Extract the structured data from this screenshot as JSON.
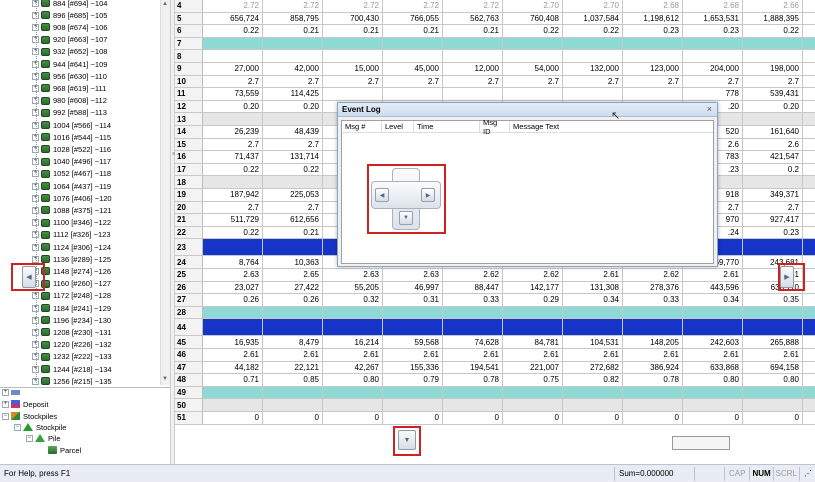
{
  "tree": {
    "blocks": [
      "884 [#694] ~104",
      "896 [#685] ~105",
      "908 [#674] ~106",
      "920 [#663] ~107",
      "932 [#652] ~108",
      "944 [#641] ~109",
      "956 [#630] ~110",
      "968 [#619] ~111",
      "980 [#608] ~112",
      "992 [#588] ~113",
      "1004 [#566] ~114",
      "1016 [#544] ~115",
      "1028 [#522] ~116",
      "1040 [#496] ~117",
      "1052 [#467] ~118",
      "1064 [#437] ~119",
      "1076 [#406] ~120",
      "1088 [#375] ~121",
      "1100 [#346] ~122",
      "1112 [#326] ~123",
      "1124 [#306] ~124",
      "1136 [#289] ~125",
      "1148 [#274] ~126",
      "1160 [#260] ~127",
      "1172 [#248] ~128",
      "1184 [#241] ~129",
      "1196 [#234] ~130",
      "1208 [#230] ~131",
      "1220 [#226] ~132",
      "1232 [#222] ~133",
      "1244 [#218] ~134",
      "1256 [#215] ~135",
      "1268 [#212] ~136"
    ],
    "bottom": {
      "deposit": "Deposit",
      "stockpiles": "Stockpiles",
      "stockpile": "Stockpile",
      "pile": "Pile",
      "parcel": "Parcel"
    }
  },
  "grid": {
    "rows": [
      {
        "n": "4",
        "style": "faded",
        "v": [
          "2.72",
          "2.72",
          "2.72",
          "2.72",
          "2.72",
          "2.70",
          "2.70",
          "2.68",
          "2.68",
          "2.66"
        ]
      },
      {
        "n": "5",
        "style": "",
        "v": [
          "656,724",
          "858,795",
          "700,430",
          "766,055",
          "562,763",
          "760,408",
          "1,037,584",
          "1,198,612",
          "1,653,531",
          "1,888,395"
        ]
      },
      {
        "n": "6",
        "style": "",
        "v": [
          "0.22",
          "0.21",
          "0.21",
          "0.21",
          "0.21",
          "0.22",
          "0.22",
          "0.23",
          "0.23",
          "0.22"
        ]
      },
      {
        "n": "7",
        "style": "band-cyan",
        "v": [
          "",
          "",
          "",
          "",
          "",
          "",
          "",
          "",
          "",
          ""
        ]
      },
      {
        "n": "8",
        "style": "",
        "v": [
          "",
          "",
          "",
          "",
          "",
          "",
          "",
          "",
          "",
          ""
        ]
      },
      {
        "n": "9",
        "style": "",
        "v": [
          "27,000",
          "42,000",
          "15,000",
          "45,000",
          "12,000",
          "54,000",
          "132,000",
          "123,000",
          "204,000",
          "198,000"
        ]
      },
      {
        "n": "10",
        "style": "",
        "v": [
          "2.7",
          "2.7",
          "2.7",
          "2.7",
          "2.7",
          "2.7",
          "2.7",
          "2.7",
          "2.7",
          "2.7"
        ]
      },
      {
        "n": "11",
        "style": "",
        "v": [
          "73,559",
          "114,425",
          "",
          "",
          "",
          "",
          "",
          "",
          "778",
          "539,431"
        ]
      },
      {
        "n": "12",
        "style": "",
        "v": [
          "0.20",
          "0.20",
          "",
          "",
          "",
          "",
          "",
          "",
          ".20",
          "0.20"
        ]
      },
      {
        "n": "13",
        "style": "band-gray",
        "v": [
          "",
          "",
          "",
          "",
          "",
          "",
          "",
          "",
          "",
          ""
        ]
      },
      {
        "n": "14",
        "style": "",
        "v": [
          "26,239",
          "48,439",
          "",
          "",
          "",
          "",
          "",
          "",
          "520",
          "161,640"
        ]
      },
      {
        "n": "15",
        "style": "",
        "v": [
          "2.7",
          "2.7",
          "",
          "",
          "",
          "",
          "",
          "",
          "2.6",
          "2.6"
        ]
      },
      {
        "n": "16",
        "style": "",
        "v": [
          "71,437",
          "131,714",
          "",
          "",
          "",
          "",
          "",
          "",
          "783",
          "421,547"
        ]
      },
      {
        "n": "17",
        "style": "",
        "v": [
          "0.22",
          "0.22",
          "",
          "",
          "",
          "",
          "",
          "",
          ".23",
          "0.2"
        ]
      },
      {
        "n": "18",
        "style": "band-gray",
        "v": [
          "",
          "",
          "",
          "",
          "",
          "",
          "",
          "",
          "",
          ""
        ]
      },
      {
        "n": "19",
        "style": "",
        "v": [
          "187,942",
          "225,053",
          "",
          "",
          "",
          "",
          "",
          "",
          "918",
          "349,371"
        ]
      },
      {
        "n": "20",
        "style": "",
        "v": [
          "2.7",
          "2.7",
          "",
          "",
          "",
          "",
          "",
          "",
          "2.7",
          "2.7"
        ]
      },
      {
        "n": "21",
        "style": "",
        "v": [
          "511,729",
          "612,656",
          "",
          "",
          "",
          "",
          "",
          "",
          "970",
          "927,417"
        ]
      },
      {
        "n": "22",
        "style": "",
        "v": [
          "0.22",
          "0.21",
          "",
          "",
          "",
          "",
          "",
          "",
          ".24",
          "0.23"
        ]
      },
      {
        "n": "23",
        "style": "band-blue",
        "v": [
          "",
          "",
          "",
          "",
          "",
          "",
          "",
          "",
          "",
          ""
        ]
      },
      {
        "n": "24",
        "style": "",
        "v": [
          "8,764",
          "10,363",
          "20,995",
          "17,891",
          "33,726",
          "54,216",
          "50,248",
          "106,448",
          "169,770",
          "243,681"
        ]
      },
      {
        "n": "25",
        "style": "",
        "v": [
          "2.63",
          "2.65",
          "2.63",
          "2.63",
          "2.62",
          "2.62",
          "2.61",
          "2.62",
          "2.61",
          "2.61"
        ]
      },
      {
        "n": "26",
        "style": "",
        "v": [
          "23,027",
          "27,422",
          "55,205",
          "46,997",
          "88,447",
          "142,177",
          "131,308",
          "278,376",
          "443,596",
          "636,110"
        ]
      },
      {
        "n": "27",
        "style": "",
        "v": [
          "0.26",
          "0.26",
          "0.32",
          "0.31",
          "0.33",
          "0.29",
          "0.34",
          "0.33",
          "0.34",
          "0.35"
        ]
      },
      {
        "n": "28",
        "style": "band-cyan",
        "v": [
          "",
          "",
          "",
          "",
          "",
          "",
          "",
          "",
          "",
          ""
        ]
      },
      {
        "n": "44",
        "style": "band-blue",
        "v": [
          "",
          "",
          "",
          "",
          "",
          "",
          "",
          "",
          "",
          ""
        ]
      },
      {
        "n": "45",
        "style": "",
        "v": [
          "16,935",
          "8,479",
          "16,214",
          "59,568",
          "74,628",
          "84,781",
          "104,531",
          "148,205",
          "242,603",
          "265,888"
        ]
      },
      {
        "n": "46",
        "style": "",
        "v": [
          "2.61",
          "2.61",
          "2.61",
          "2.61",
          "2.61",
          "2.61",
          "2.61",
          "2.61",
          "2.61",
          "2.61"
        ]
      },
      {
        "n": "47",
        "style": "",
        "v": [
          "44,182",
          "22,121",
          "42,267",
          "155,336",
          "194,541",
          "221,007",
          "272,682",
          "386,924",
          "633,868",
          "694,158"
        ]
      },
      {
        "n": "48",
        "style": "",
        "v": [
          "0.71",
          "0.85",
          "0.80",
          "0.79",
          "0.78",
          "0.75",
          "0.82",
          "0.78",
          "0.80",
          "0.80"
        ]
      },
      {
        "n": "49",
        "style": "band-cyan",
        "v": [
          "",
          "",
          "",
          "",
          "",
          "",
          "",
          "",
          "",
          ""
        ]
      },
      {
        "n": "50",
        "style": "band-gray",
        "v": [
          "",
          "",
          "",
          "",
          "",
          "",
          "",
          "",
          "",
          ""
        ]
      },
      {
        "n": "51",
        "style": "",
        "v": [
          "0",
          "0",
          "0",
          "0",
          "0",
          "0",
          "0",
          "0",
          "0",
          "0"
        ]
      }
    ]
  },
  "event_log": {
    "title": "Event Log",
    "close": "×",
    "columns": [
      "Msg #",
      "Level",
      "Time",
      "Msg ID",
      "Message Text"
    ]
  },
  "status": {
    "help": "For Help, press F1",
    "sum": "Sum=0.000000",
    "cap": "CAP",
    "num": "NUM",
    "scrl": "SCRL"
  }
}
